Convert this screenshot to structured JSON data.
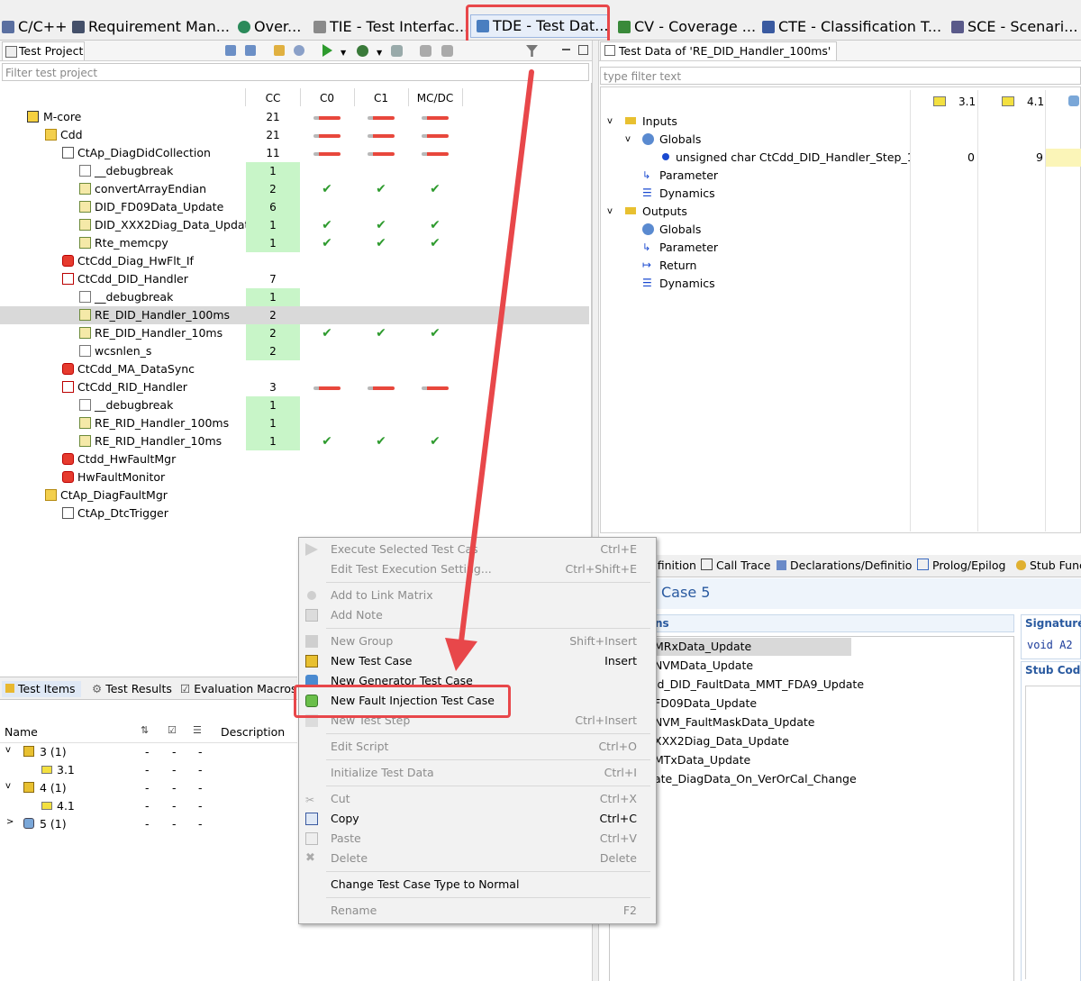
{
  "perspectives": [
    {
      "label": "C/C++",
      "icon": "c-cpp-icon",
      "color": "#5a6fa0"
    },
    {
      "label": "Requirement Man...",
      "icon": "requirement-icon",
      "color": "#44506a"
    },
    {
      "label": "Over...",
      "icon": "globe-icon",
      "color": "#2b8a5a"
    },
    {
      "label": "TIE - Test Interfac...",
      "icon": "interface-icon",
      "color": "#8a8a8a"
    },
    {
      "label": "TDE - Test Dat...",
      "icon": "test-data-icon",
      "color": "#4a7ec0"
    },
    {
      "label": "CV - Coverage ...",
      "icon": "coverage-icon",
      "color": "#3a8a3a"
    },
    {
      "label": "CTE - Classification T...",
      "icon": "classification-icon",
      "color": "#3a5aa0"
    },
    {
      "label": "SCE - Scenari...",
      "icon": "scenario-icon",
      "color": "#5a5a8a"
    }
  ],
  "test_project": {
    "tab": "Test Project",
    "filter_placeholder": "Filter test project",
    "columns": [
      "CC",
      "C0",
      "C1",
      "MC/DC"
    ],
    "rows": [
      {
        "label": "M-core",
        "cc": "21"
      },
      {
        "label": "Cdd",
        "cc": "21"
      },
      {
        "label": "CtAp_DiagDidCollection",
        "cc": "11"
      },
      {
        "label": "__debugbreak",
        "cc": "1"
      },
      {
        "label": "convertArrayEndian",
        "cc": "2"
      },
      {
        "label": "DID_FD09Data_Update",
        "cc": "6"
      },
      {
        "label": "DID_XXX2Diag_Data_Update",
        "cc": "1"
      },
      {
        "label": "Rte_memcpy",
        "cc": "1"
      },
      {
        "label": "CtCdd_Diag_HwFlt_If",
        "cc": ""
      },
      {
        "label": "CtCdd_DID_Handler",
        "cc": "7"
      },
      {
        "label": "__debugbreak",
        "cc": "1"
      },
      {
        "label": "RE_DID_Handler_100ms",
        "cc": "2"
      },
      {
        "label": "RE_DID_Handler_10ms",
        "cc": "2"
      },
      {
        "label": "wcsnlen_s",
        "cc": "2"
      },
      {
        "label": "CtCdd_MA_DataSync",
        "cc": ""
      },
      {
        "label": "CtCdd_RID_Handler",
        "cc": "3"
      },
      {
        "label": "__debugbreak",
        "cc": "1"
      },
      {
        "label": "RE_RID_Handler_100ms",
        "cc": "1"
      },
      {
        "label": "RE_RID_Handler_10ms",
        "cc": "1"
      },
      {
        "label": "Ctdd_HwFaultMgr",
        "cc": ""
      },
      {
        "label": "HwFaultMonitor",
        "cc": ""
      },
      {
        "label": "CtAp_DiagFaultMgr",
        "cc": ""
      },
      {
        "label": "CtAp_DtcTrigger",
        "cc": ""
      }
    ]
  },
  "test_items": {
    "tabs": [
      "Test Items",
      "Test Results",
      "Evaluation Macros"
    ],
    "headers": {
      "name": "Name",
      "description": "Description"
    },
    "rows": [
      {
        "label": "3 (1)",
        "a": "-",
        "b": "-",
        "c": "-"
      },
      {
        "label": "3.1",
        "a": "-",
        "b": "-",
        "c": "-"
      },
      {
        "label": "4 (1)",
        "a": "-",
        "b": "-",
        "c": "-"
      },
      {
        "label": "4.1",
        "a": "-",
        "b": "-",
        "c": "-"
      },
      {
        "label": "5 (1)",
        "a": "-",
        "b": "-",
        "c": "-"
      }
    ]
  },
  "test_data": {
    "tab": "Test Data of 'RE_DID_Handler_100ms'",
    "filter_placeholder": "type filter text",
    "columns": [
      "3.1",
      "4.1"
    ],
    "rows": [
      {
        "label": "Inputs"
      },
      {
        "label": "Globals"
      },
      {
        "label": "unsigned char CtCdd_DID_Handler_Step_100",
        "v1": "0",
        "v2": "9"
      },
      {
        "label": "Parameter"
      },
      {
        "label": "Dynamics"
      },
      {
        "label": "Outputs"
      },
      {
        "label": "Globals"
      },
      {
        "label": "Parameter"
      },
      {
        "label": "Return"
      },
      {
        "label": "Dynamics"
      }
    ]
  },
  "lower_right": {
    "tabs": [
      "efinition",
      "Call Trace",
      "Declarations/Definitio",
      "Prolog/Epilog",
      "Stub Func"
    ],
    "title": "Case 5",
    "section_left": "ns",
    "section_signature": "Signature",
    "section_stub_code": "Stub Code",
    "signature_code": "void A2",
    "items": [
      "MRxData_Update",
      "NVMData_Update",
      "ld_DID_FaultData_MMT_FDA9_Update",
      "FD09Data_Update",
      "NVM_FaultMaskData_Update",
      "XXX2Diag_Data_Update",
      "MTxData_Update",
      "ate_DiagData_On_VerOrCal_Change"
    ]
  },
  "context_menu": {
    "items": [
      {
        "label": "Execute Selected Test Cas",
        "shortcut": "Ctrl+E"
      },
      {
        "label": "Edit Test Execution Setting...",
        "shortcut": "Ctrl+Shift+E"
      },
      {
        "label": "Add to Link Matrix",
        "shortcut": ""
      },
      {
        "label": "Add Note",
        "shortcut": ""
      },
      {
        "label": "New Group",
        "shortcut": "Shift+Insert"
      },
      {
        "label": "New Test Case",
        "shortcut": "Insert"
      },
      {
        "label": "New Generator Test Case",
        "shortcut": ""
      },
      {
        "label": "New Fault Injection Test Case",
        "shortcut": ""
      },
      {
        "label": "New Test Step",
        "shortcut": "Ctrl+Insert"
      },
      {
        "label": "Edit Script",
        "shortcut": "Ctrl+O"
      },
      {
        "label": "Initialize Test Data",
        "shortcut": "Ctrl+I"
      },
      {
        "label": "Cut",
        "shortcut": "Ctrl+X"
      },
      {
        "label": "Copy",
        "shortcut": "Ctrl+C"
      },
      {
        "label": "Paste",
        "shortcut": "Ctrl+V"
      },
      {
        "label": "Delete",
        "shortcut": "Delete"
      },
      {
        "label": "Change Test Case Type to Normal",
        "shortcut": ""
      },
      {
        "label": "Rename",
        "shortcut": "F2"
      }
    ]
  },
  "colors": {
    "highlight": "#e8474a",
    "cc_green": "#c8f5c8",
    "check_green": "#2e9b2e",
    "selection": "#d9d9d9"
  }
}
